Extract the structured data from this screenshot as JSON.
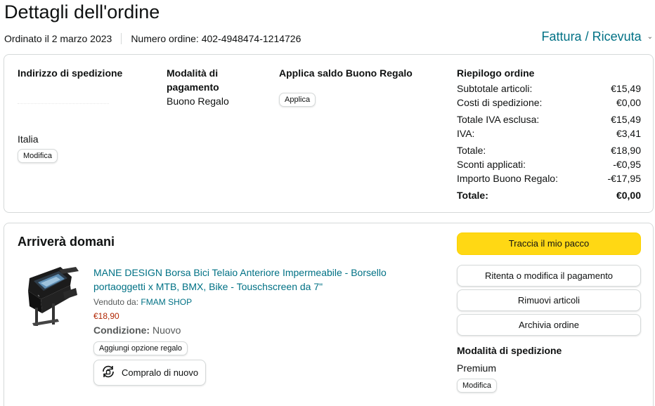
{
  "header": {
    "title": "Dettagli dell'ordine",
    "ordered_on": "Ordinato il 2 marzo 2023",
    "order_number": "Numero ordine: 402-4948474-1214726",
    "invoice_link": "Fattura / Ricevuta"
  },
  "summary": {
    "shipping_address": {
      "heading": "Indirizzo di spedizione",
      "country": "Italia",
      "edit_label": "Modifica"
    },
    "payment": {
      "heading": "Modalità di pagamento",
      "method": "Buono Regalo"
    },
    "gift_card": {
      "heading": "Applica saldo Buono Regalo",
      "apply_label": "Applica"
    },
    "order_summary": {
      "heading": "Riepilogo ordine",
      "rows": [
        {
          "label": "Subtotale articoli:",
          "value": "€15,49"
        },
        {
          "label": "Costi di spedizione:",
          "value": "€0,00"
        },
        {
          "label": "Totale IVA esclusa:",
          "value": "€15,49"
        },
        {
          "label": "IVA:",
          "value": "€3,41"
        },
        {
          "label": "Totale:",
          "value": "€18,90"
        },
        {
          "label": "Sconti applicati:",
          "value": "-€0,95"
        },
        {
          "label": "Importo Buono Regalo:",
          "value": "-€17,95"
        }
      ],
      "grand_total_label": "Totale:",
      "grand_total_value": "€0,00"
    }
  },
  "shipment": {
    "arrival": "Arriverà domani",
    "product": {
      "title": "MANE DESIGN Borsa Bici Telaio Anteriore Impermeabile - Borsello portaoggetti x MTB, BMX, Bike - Touschscreen da 7\"",
      "sold_by_label": "Venduto da:",
      "seller": "FMAM SHOP",
      "price": "€18,90",
      "condition_label": "Condizione:",
      "condition_value": "Nuovo",
      "gift_option_label": "Aggiungi opzione regalo",
      "buy_again_label": "Compralo di nuovo"
    },
    "actions": {
      "track": "Traccia il mio pacco",
      "retry_payment": "Ritenta o modifica il pagamento",
      "remove_items": "Rimuovi articoli",
      "archive": "Archivia ordine"
    },
    "shipping_mode": {
      "heading": "Modalità di spedizione",
      "value": "Premium",
      "edit_label": "Modifica"
    }
  },
  "colors": {
    "link": "#007185",
    "price": "#b12704",
    "primary_button": "#ffd814",
    "border": "#d5d9d9"
  },
  "icons": {
    "invoice_dropdown": "chevron-down-icon",
    "buy_again": "reorder-icon"
  }
}
